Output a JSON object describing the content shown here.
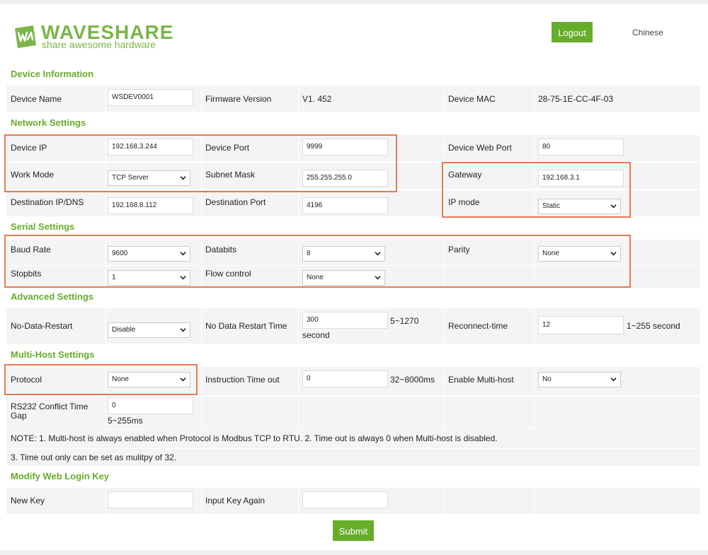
{
  "brand": {
    "name": "WAVESHARE",
    "tagline": "share awesome hardware"
  },
  "header": {
    "logout_label": "Logout",
    "language_label": "Chinese"
  },
  "device_info": {
    "title": "Device Information",
    "device_name_label": "Device Name",
    "device_name_value": "WSDEV0001",
    "firmware_label": "Firmware Version",
    "firmware_value": "V1. 452",
    "mac_label": "Device MAC",
    "mac_value": "28-75-1E-CC-4F-03"
  },
  "network": {
    "title": "Network Settings",
    "device_ip_label": "Device IP",
    "device_ip_value": "192.168.3.244",
    "device_port_label": "Device Port",
    "device_port_value": "9999",
    "web_port_label": "Device Web Port",
    "web_port_value": "80",
    "work_mode_label": "Work Mode",
    "work_mode_value": "TCP Server",
    "subnet_label": "Subnet Mask",
    "subnet_value": "255.255.255.0",
    "gateway_label": "Gateway",
    "gateway_value": "192.168.3.1",
    "dest_ip_label": "Destination IP/DNS",
    "dest_ip_value": "192.168.8.112",
    "dest_port_label": "Destination Port",
    "dest_port_value": "4196",
    "ip_mode_label": "IP mode",
    "ip_mode_value": "Static"
  },
  "serial": {
    "title": "Serial Settings",
    "baud_label": "Baud Rate",
    "baud_value": "9600",
    "databits_label": "Databits",
    "databits_value": "8",
    "parity_label": "Parity",
    "parity_value": "None",
    "stopbits_label": "Stopbits",
    "stopbits_value": "1",
    "flow_label": "Flow control",
    "flow_value": "None"
  },
  "advanced": {
    "title": "Advanced Settings",
    "no_data_restart_label": "No-Data-Restart",
    "no_data_restart_value": "Disable",
    "restart_time_label": "No Data Restart Time",
    "restart_time_value": "300",
    "restart_time_range": "5~1270",
    "restart_time_unit": "second",
    "reconnect_label": "Reconnect-time",
    "reconnect_value": "12",
    "reconnect_range": "1~255 second"
  },
  "multihost": {
    "title": "Multi-Host Settings",
    "protocol_label": "Protocol",
    "protocol_value": "None",
    "timeout_label": "Instruction Time out",
    "timeout_value": "0",
    "timeout_range": "32~8000ms",
    "enable_label": "Enable Multi-host",
    "enable_value": "No",
    "conflict_label_1": "RS232 Conflict Time",
    "conflict_label_2": "Gap",
    "conflict_value": "0",
    "conflict_range": "5~255ms",
    "note_1": "NOTE: 1. Multi-host is always enabled when Protocol is Modbus TCP to RTU. 2. Time out is always 0 when Multi-host is disabled.",
    "note_2": "3. Time out only can be set as mulitpy of 32."
  },
  "login_key": {
    "title": "Modify Web Login Key",
    "new_key_label": "New Key",
    "new_key_value": "",
    "again_label": "Input Key Again",
    "again_value": ""
  },
  "footer": {
    "submit_label": "Submit"
  },
  "colors": {
    "accent": "#67ad2a",
    "highlight": "#e67a52",
    "row_bg": "#f4f4f4"
  },
  "icons": {
    "select_arrow": "chevron-down-icon",
    "logo": "waveshare-logo-icon"
  }
}
